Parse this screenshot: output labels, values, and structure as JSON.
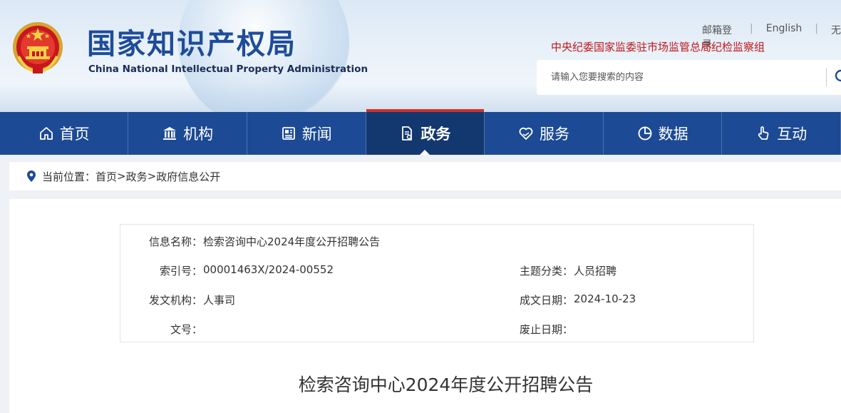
{
  "header": {
    "title": "国家知识产权局",
    "subtitle": "China National Intellectual Property Administration",
    "links": [
      "邮箱登录",
      "English",
      "无"
    ],
    "notice": "中央纪委国家监委驻市场监管总局纪检监察组",
    "search": {
      "placeholder": "请输入您要搜索的内容"
    }
  },
  "nav": {
    "items": [
      {
        "label": "首页",
        "icon": "home-icon"
      },
      {
        "label": "机构",
        "icon": "institution-icon"
      },
      {
        "label": "新闻",
        "icon": "news-icon"
      },
      {
        "label": "政务",
        "icon": "document-icon",
        "active": true
      },
      {
        "label": "服务",
        "icon": "heart-hand-icon"
      },
      {
        "label": "数据",
        "icon": "pie-chart-icon"
      },
      {
        "label": "互动",
        "icon": "hand-pointer-icon"
      }
    ]
  },
  "breadcrumb": {
    "prefix": "当前位置：",
    "items": [
      "首页",
      "政务",
      "政府信息公开"
    ],
    "separator": ">"
  },
  "info": {
    "name_label": "信息名称：",
    "name_value": "检索咨询中心2024年度公开招聘公告",
    "index_label": "索引号：",
    "index_value": "00001463X/2024-00552",
    "topic_label": "主题分类：",
    "topic_value": "人员招聘",
    "org_label": "发文机构：",
    "org_value": "人事司",
    "date_label": "成文日期：",
    "date_value": "2024-10-23",
    "docno_label": "文号：",
    "docno_value": "",
    "expire_label": "废止日期：",
    "expire_value": ""
  },
  "document": {
    "title": "检索咨询中心2024年度公开招聘公告"
  },
  "colors": {
    "nav_bg": "#1c4a94",
    "nav_active": "#13386f",
    "accent_red": "#c0161b",
    "title_blue": "#1e4c9a"
  }
}
